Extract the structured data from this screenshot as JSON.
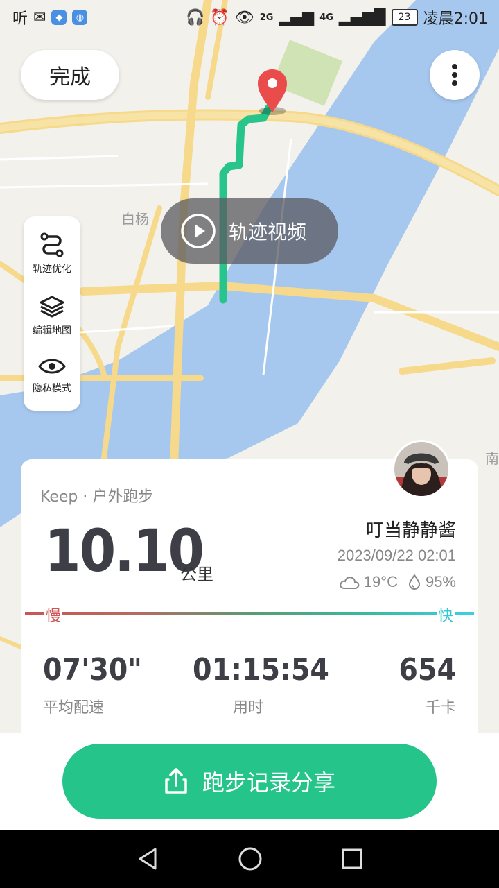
{
  "status_bar": {
    "left_text": "听",
    "time": "凌晨2:01",
    "battery": "23",
    "net1": "2G",
    "net2": "4G"
  },
  "map": {
    "place_label": "白杨",
    "edge_label": "南",
    "colors": {
      "water": "#a7c8ee",
      "road": "#f6d98a",
      "route": "#27c48b",
      "pin": "#ea4b4b"
    }
  },
  "top_controls": {
    "done_label": "完成",
    "more_icon": "more-vertical-icon"
  },
  "video_button": {
    "label": "轨迹视频",
    "icon": "play-circle-icon"
  },
  "map_tools": [
    {
      "label": "轨迹优化",
      "icon": "route-icon"
    },
    {
      "label": "编辑地图",
      "icon": "layers-icon"
    },
    {
      "label": "隐私模式",
      "icon": "eye-icon"
    }
  ],
  "summary": {
    "source": "Keep · 户外跑步",
    "distance": "10.10",
    "distance_unit": "公里",
    "username": "叮当静静酱",
    "datetime": "2023/09/22 02:01",
    "temperature": "19°C",
    "humidity": "95%",
    "pace_slow_label": "慢",
    "pace_fast_label": "快",
    "stats": [
      {
        "value": "07'30\"",
        "label": "平均配速"
      },
      {
        "value": "01:15:54",
        "label": "用时"
      },
      {
        "value": "654",
        "label": "千卡"
      }
    ]
  },
  "share": {
    "label": "跑步记录分享",
    "icon": "share-upload-icon",
    "color": "#25c48b"
  },
  "nav_bar": {
    "back": "back-triangle-icon",
    "home": "home-circle-icon",
    "recents": "recents-square-icon"
  }
}
